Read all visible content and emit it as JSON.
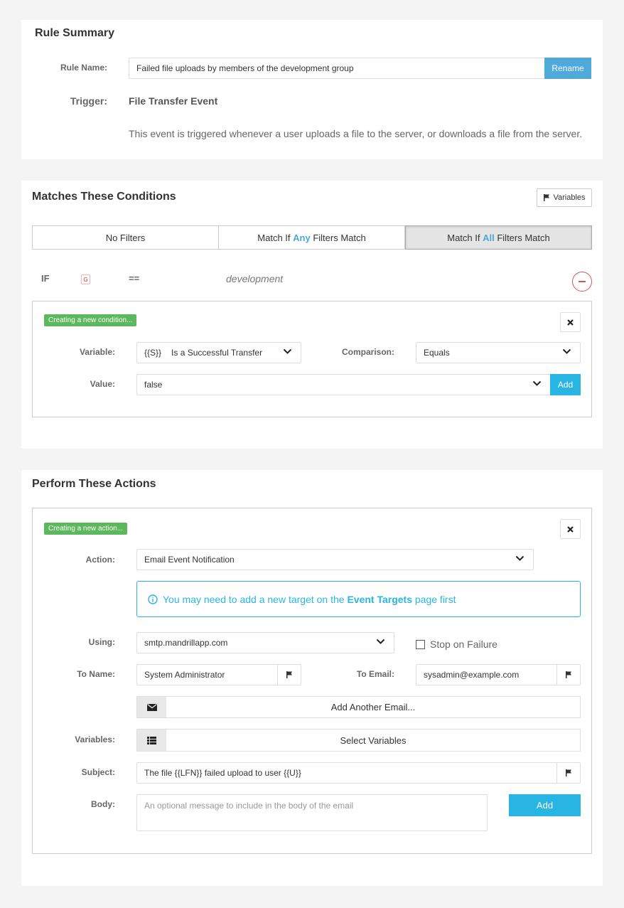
{
  "rule_summary": {
    "title": "Rule Summary",
    "rule_name_label": "Rule Name:",
    "rule_name_value": "Failed file uploads by members of the development group",
    "rename_label": "Rename",
    "trigger_label": "Trigger:",
    "trigger_value": "File Transfer Event",
    "trigger_description": "This event is triggered whenever a user uploads a file to the server, or downloads a file from the server."
  },
  "conditions": {
    "title": "Matches These Conditions",
    "variables_label": "Variables",
    "filters": {
      "none": "No Filters",
      "any_prefix": "Match If ",
      "any_word": "Any",
      "any_suffix": " Filters Match",
      "all_prefix": "Match If ",
      "all_word": "All",
      "all_suffix": " Filters Match",
      "selected": "all"
    },
    "existing": {
      "if_label": "IF",
      "var_badge": "G",
      "operator": "==",
      "value": "development"
    },
    "new": {
      "badge": "Creating a new condition...",
      "variable_label": "Variable:",
      "variable_code": "{{S}}",
      "variable_name": "Is a Successful Transfer",
      "comparison_label": "Comparison:",
      "comparison_value": "Equals",
      "value_label": "Value:",
      "value_value": "false",
      "add_label": "Add"
    }
  },
  "actions": {
    "title": "Perform These Actions",
    "badge": "Creating a new action...",
    "action_label": "Action:",
    "action_value": "Email Event Notification",
    "info_prefix": "You may need to add a new target on the ",
    "info_link": "Event Targets",
    "info_suffix": " page first",
    "using_label": "Using:",
    "using_value": "smtp.mandrillapp.com",
    "stop_on_failure_label": "Stop on Failure",
    "stop_on_failure_checked": false,
    "to_name_label": "To Name:",
    "to_name_value": "System Administrator",
    "to_email_label": "To Email:",
    "to_email_value": "sysadmin@example.com",
    "add_email_label": "Add Another Email...",
    "variables_label": "Variables:",
    "select_variables_label": "Select Variables",
    "subject_label": "Subject:",
    "subject_value": "The file {{LFN}} failed upload to user {{U}}",
    "body_label": "Body:",
    "body_placeholder": "An optional message to include in the body of the email",
    "add_label": "Add"
  },
  "colors": {
    "accent": "#29b5e4",
    "badge_green": "#5cb85c",
    "remove_red": "#d9534f"
  }
}
